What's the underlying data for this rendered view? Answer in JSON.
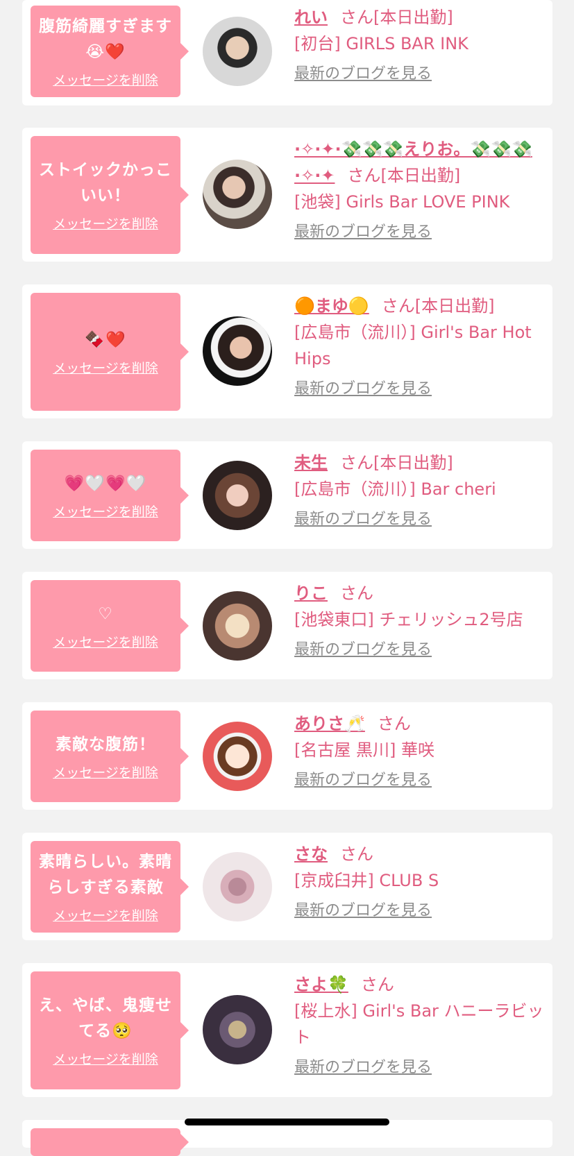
{
  "items": [
    {
      "message": "腹筋綺麗すぎます😭❤️",
      "delete": "メッセージを削除",
      "name": "れい",
      "suffix": "さん[本日出勤]",
      "shop": "[初台] GIRLS BAR INK",
      "blog": "最新のブログを見る"
    },
    {
      "message": "ストイックかっこいい！",
      "delete": "メッセージを削除",
      "name": "·✧·✦·💸💸💸えりお。💸💸💸·✧·✦",
      "suffix": "さん[本日出勤]",
      "shop": "[池袋] Girls Bar LOVE PINK",
      "blog": "最新のブログを見る"
    },
    {
      "message": "🍫❤️",
      "delete": "メッセージを削除",
      "name": "🟠まゆ🟡",
      "suffix": "さん[本日出勤]",
      "shop": "[広島市（流川）] Girl's Bar Hot Hips",
      "blog": "最新のブログを見る"
    },
    {
      "message": "💗🤍💗🤍",
      "delete": "メッセージを削除",
      "name": "未生",
      "suffix": "さん[本日出勤]",
      "shop": "[広島市（流川）] Bar cheri",
      "blog": "最新のブログを見る"
    },
    {
      "message": "♡",
      "delete": "メッセージを削除",
      "name": "りこ",
      "suffix": "さん",
      "shop": "[池袋東口] チェリッシュ2号店",
      "blog": "最新のブログを見る"
    },
    {
      "message": "素敵な腹筋！",
      "delete": "メッセージを削除",
      "name": "ありさ🥂",
      "suffix": "さん",
      "shop": "[名古屋 黒川] 華咲",
      "blog": "最新のブログを見る"
    },
    {
      "message": "素晴らしい。素晴らしすぎる素敵",
      "delete": "メッセージを削除",
      "name": "さな",
      "suffix": "さん",
      "shop": "[京成臼井] CLUB S",
      "blog": "最新のブログを見る"
    },
    {
      "message": "え、やば、鬼痩せてる🥺",
      "delete": "メッセージを削除",
      "name": "さよ🍀",
      "suffix": "さん",
      "shop": "[桜上水] Girl's Bar ハニーラビット",
      "blog": "最新のブログを見る"
    }
  ],
  "colors": {
    "bubble": "#fe9aab",
    "accent": "#e05c7f",
    "link_gray": "#8c8c8c",
    "background": "#f2f2f2"
  }
}
